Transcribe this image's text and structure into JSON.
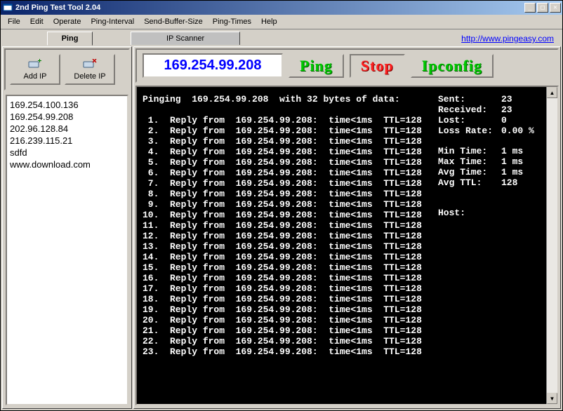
{
  "window": {
    "title": "2nd Ping Test Tool 2.04"
  },
  "menu": [
    "File",
    "Edit",
    "Operate",
    "Ping-Interval",
    "Send-Buffer-Size",
    "Ping-Times",
    "Help"
  ],
  "tabs": {
    "left": "Ping",
    "right": "IP Scanner"
  },
  "url": "http://www.pingeasy.com",
  "buttons": {
    "addip": "Add IP",
    "deleteip": "Delete IP",
    "ping": "Ping",
    "stop": "Stop",
    "ipconfig": "Ipconfig"
  },
  "ipbox": "169.254.99.208",
  "iplist": [
    "169.254.100.136",
    "169.254.99.208",
    "202.96.128.84",
    "216.239.115.21",
    "sdfd",
    "www.download.com"
  ],
  "console": {
    "header": "Pinging  169.254.99.208  with 32 bytes of data:",
    "lines": [
      " 1.  Reply from  169.254.99.208:  time<1ms  TTL=128",
      " 2.  Reply from  169.254.99.208:  time<1ms  TTL=128",
      " 3.  Reply from  169.254.99.208:  time<1ms  TTL=128",
      " 4.  Reply from  169.254.99.208:  time<1ms  TTL=128",
      " 5.  Reply from  169.254.99.208:  time<1ms  TTL=128",
      " 6.  Reply from  169.254.99.208:  time<1ms  TTL=128",
      " 7.  Reply from  169.254.99.208:  time<1ms  TTL=128",
      " 8.  Reply from  169.254.99.208:  time<1ms  TTL=128",
      " 9.  Reply from  169.254.99.208:  time<1ms  TTL=128",
      "10.  Reply from  169.254.99.208:  time<1ms  TTL=128",
      "11.  Reply from  169.254.99.208:  time<1ms  TTL=128",
      "12.  Reply from  169.254.99.208:  time<1ms  TTL=128",
      "13.  Reply from  169.254.99.208:  time<1ms  TTL=128",
      "14.  Reply from  169.254.99.208:  time<1ms  TTL=128",
      "15.  Reply from  169.254.99.208:  time<1ms  TTL=128",
      "16.  Reply from  169.254.99.208:  time<1ms  TTL=128",
      "17.  Reply from  169.254.99.208:  time<1ms  TTL=128",
      "18.  Reply from  169.254.99.208:  time<1ms  TTL=128",
      "19.  Reply from  169.254.99.208:  time<1ms  TTL=128",
      "20.  Reply from  169.254.99.208:  time<1ms  TTL=128",
      "21.  Reply from  169.254.99.208:  time<1ms  TTL=128",
      "22.  Reply from  169.254.99.208:  time<1ms  TTL=128",
      "23.  Reply from  169.254.99.208:  time<1ms  TTL=128"
    ]
  },
  "stats": {
    "sent_l": "Sent:",
    "sent_v": "23",
    "recv_l": "Received:",
    "recv_v": "23",
    "lost_l": "Lost:",
    "lost_v": "0",
    "rate_l": "Loss Rate:",
    "rate_v": "0.00 %",
    "min_l": "Min Time:",
    "min_v": "1 ms",
    "max_l": "Max Time:",
    "max_v": "1 ms",
    "avg_l": "Avg Time:",
    "avg_v": "1 ms",
    "ttl_l": "Avg TTL:",
    "ttl_v": "128",
    "host_l": "Host:",
    "host_v": ""
  }
}
